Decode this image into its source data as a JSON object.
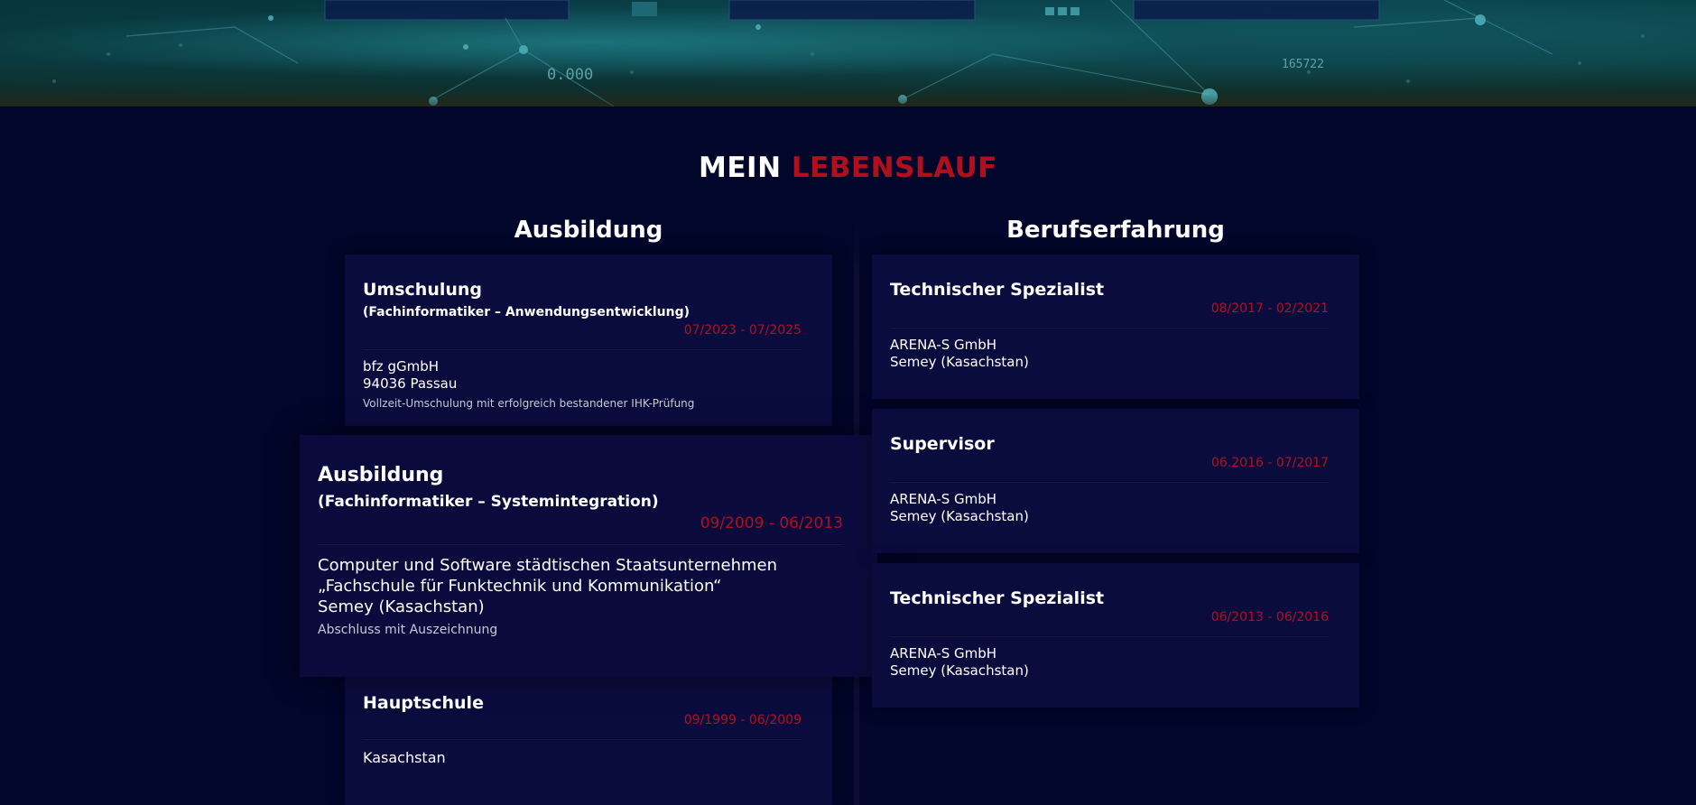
{
  "section": {
    "title_part1": "MEIN",
    "title_part2": "LEBENSLAUF",
    "accent_color": "#b0101e"
  },
  "education": {
    "heading": "Ausbildung",
    "items": [
      {
        "title": "Umschulung",
        "subtitle": "(Fachinformatiker – Anwendungsentwicklung)",
        "date": "07/2023 - 07/2025",
        "lines": [
          "bfz gGmbH",
          "94036 Passau"
        ],
        "note": "Vollzeit-Umschulung mit erfolgreich bestandener IHK-Prüfung"
      },
      {
        "title": "Ausbildung",
        "subtitle": "(Fachinformatiker – Systemintegration)",
        "date": "09/2009 - 06/2013",
        "lines": [
          "Computer und Software städtischen Staatsunternehmen",
          "„Fachschule für Funktechnik und Kommunikation“",
          "Semey (Kasachstan)"
        ],
        "note": "Abschluss mit Auszeichnung"
      },
      {
        "title": "Hauptschule",
        "date": "09/1999 - 06/2009",
        "lines": [
          "Kasachstan"
        ]
      }
    ]
  },
  "experience": {
    "heading": "Berufserfahrung",
    "items": [
      {
        "title": "Technischer Spezialist",
        "date": "08/2017 - 02/2021",
        "lines": [
          "ARENA-S GmbH",
          "Semey (Kasachstan)"
        ]
      },
      {
        "title": "Supervisor",
        "date": "06.2016 - 07/2017",
        "lines": [
          "ARENA-S GmbH",
          "Semey (Kasachstan)"
        ]
      },
      {
        "title": "Technischer Spezialist",
        "date": "06/2013 - 06/2016",
        "lines": [
          "ARENA-S GmbH",
          "Semey (Kasachstan)"
        ]
      }
    ]
  },
  "hero_readouts": [
    "0.000",
    "165722"
  ]
}
